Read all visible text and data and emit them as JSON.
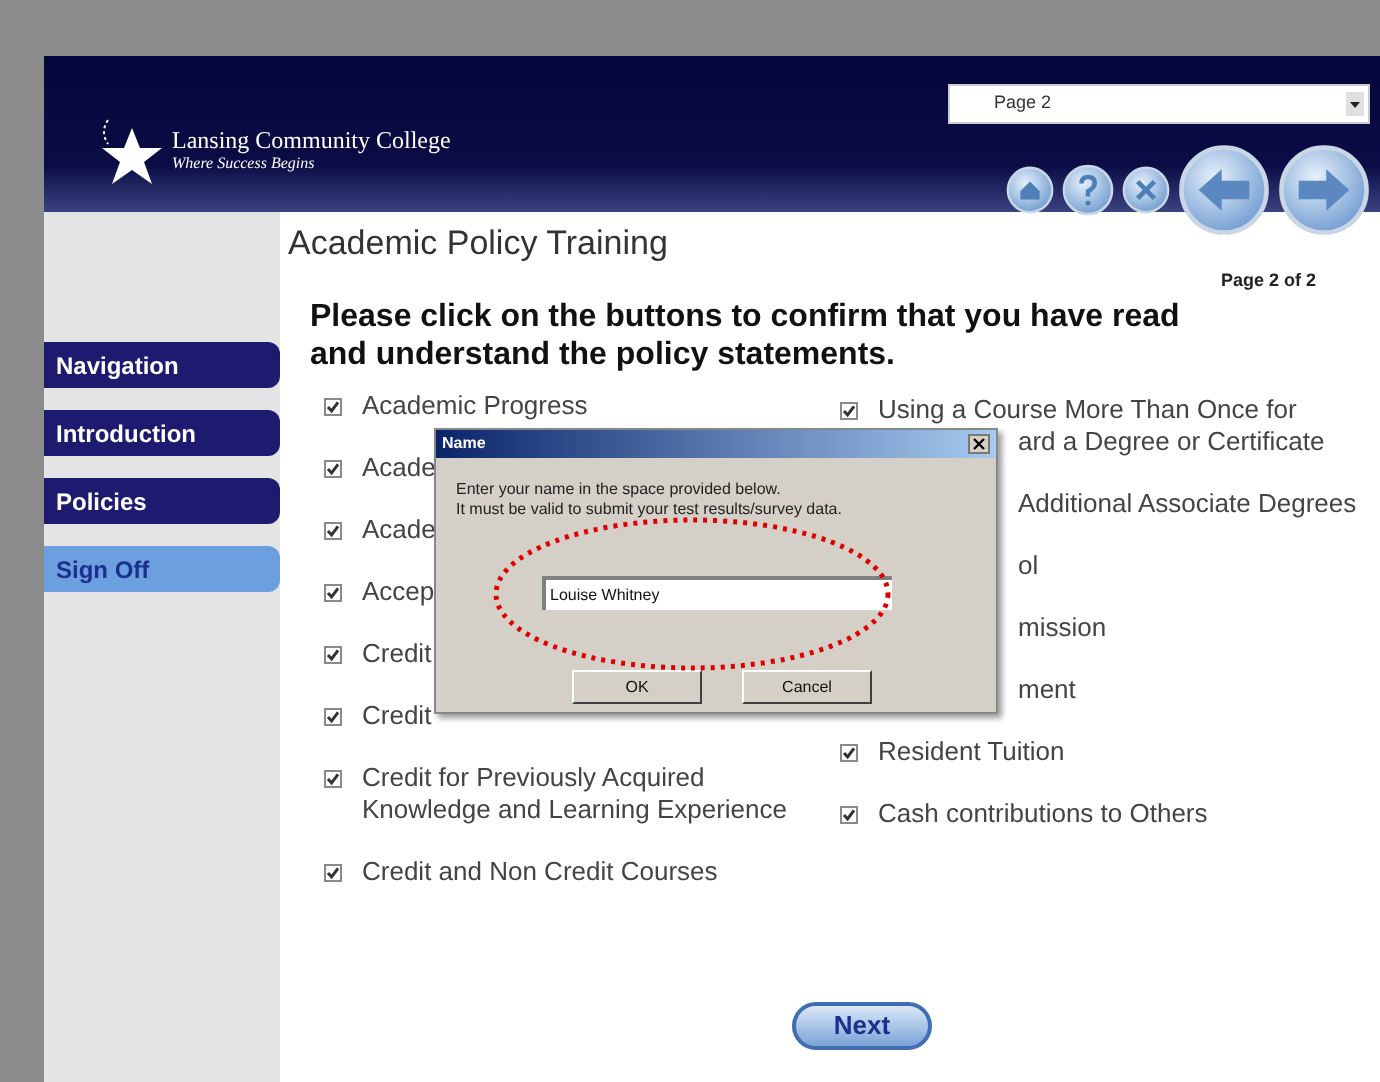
{
  "header": {
    "college": "Lansing Community College",
    "tagline": "Where Success Begins",
    "page_select": "Page 2"
  },
  "sidebar": {
    "items": [
      {
        "label": "Navigation",
        "selected": false
      },
      {
        "label": "Introduction",
        "selected": false
      },
      {
        "label": "Policies",
        "selected": false
      },
      {
        "label": "Sign Off",
        "selected": true
      }
    ]
  },
  "main": {
    "title": "Academic Policy Training",
    "page_indicator": "Page 2 of 2",
    "instructions": "Please click on the buttons to confirm that you have read and understand the policy statements.",
    "left_items": [
      {
        "lines": [
          "Academic Progress"
        ],
        "checked": true
      },
      {
        "lines": [
          "Acade"
        ],
        "checked": true
      },
      {
        "lines": [
          "Acade"
        ],
        "checked": true
      },
      {
        "lines": [
          "Accep"
        ],
        "checked": true
      },
      {
        "lines": [
          "Credit"
        ],
        "checked": true
      },
      {
        "lines": [
          "Credit"
        ],
        "checked": true
      },
      {
        "lines": [
          "Credit for Previously Acquired",
          "Knowledge and Learning Experience"
        ],
        "checked": true
      },
      {
        "lines": [
          "Credit and Non Credit Courses"
        ],
        "checked": true
      }
    ],
    "right_items": [
      {
        "lines": [
          "Using a Course More Than Once for"
        ],
        "partly_hidden_lines": [
          "ard a Degree or Certificate"
        ],
        "checked": true
      },
      {
        "partly_hidden_lines": [
          "Additional Associate Degrees"
        ]
      },
      {
        "partly_hidden_lines": [
          "ol"
        ]
      },
      {
        "partly_hidden_lines": [
          "mission"
        ]
      },
      {
        "partly_hidden_lines": [
          "ment"
        ]
      },
      {
        "lines": [
          "Resident Tuition"
        ],
        "checked": true
      },
      {
        "lines": [
          "Cash contributions to Others"
        ],
        "checked": true
      }
    ],
    "next_button": "Next"
  },
  "dialog": {
    "title": "Name",
    "message": [
      "Enter your name in the space provided below.",
      "It must be valid to submit your test results/survey data."
    ],
    "name_value": "Louise Whitney",
    "buttons": [
      "OK",
      "Cancel"
    ]
  }
}
